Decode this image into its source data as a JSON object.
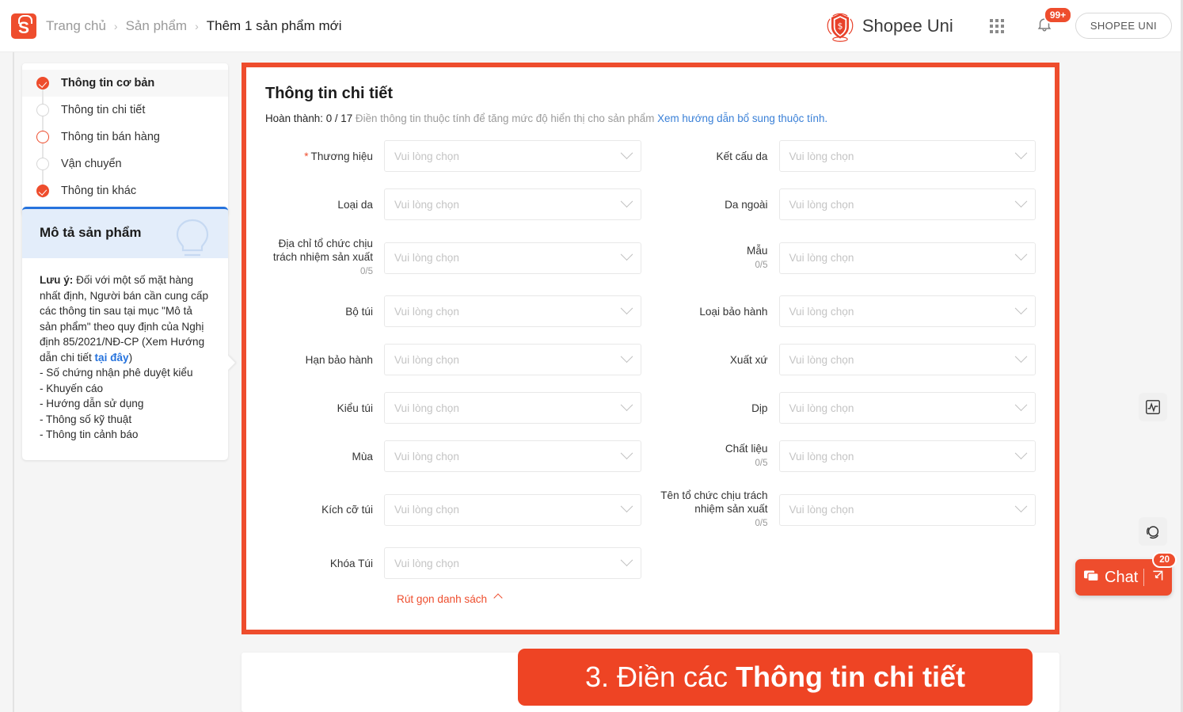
{
  "header": {
    "logo_icon": "shopee-bag-icon",
    "logo_letter": "S",
    "breadcrumb": [
      {
        "label": "Trang chủ",
        "active": false
      },
      {
        "label": "Sản phẩm",
        "active": false
      },
      {
        "label": "Thêm 1 sản phẩm mới",
        "active": true
      }
    ],
    "separator": "›",
    "uni_title": "Shopee Uni",
    "uni_logo_icon": "shopee-uni-shield-icon",
    "grid_icon": "apps-grid-icon",
    "bell_icon": "notification-bell-icon",
    "notification_badge": "99+",
    "account_pill": "SHOPEE UNI"
  },
  "sidebar": {
    "items": [
      {
        "label": "Thông tin cơ bản",
        "state": "done",
        "current": true
      },
      {
        "label": "Thông tin chi tiết",
        "state": "empty",
        "current": false
      },
      {
        "label": "Thông tin bán hàng",
        "state": "active-ring",
        "current": false
      },
      {
        "label": "Vận chuyển",
        "state": "empty",
        "current": false
      },
      {
        "label": "Thông tin khác",
        "state": "done",
        "current": false
      }
    ]
  },
  "description_card": {
    "title": "Mô tả sản phẩm",
    "bulb_icon": "lightbulb-icon",
    "note_label": "Lưu ý:",
    "note_text": " Đối với một số mặt hàng nhất định, Người bán cần cung cấp các thông tin sau tại mục \"Mô tả sản phẩm\" theo quy định của Nghị định 85/2021/NĐ-CP (Xem Hướng dẫn chi tiết ",
    "note_link": "tại đây",
    "note_text_after": ")",
    "bullets": [
      "- Số chứng nhận phê duyệt kiểu",
      "- Khuyến cáo",
      "- Hướng dẫn sử dụng",
      "- Thông số kỹ thuật",
      "- Thông tin cảnh báo"
    ]
  },
  "main": {
    "title": "Thông tin chi tiết",
    "progress_prefix": "Hoàn thành: ",
    "progress_value": "0 / 17",
    "progress_text": " Điền thông tin thuộc tính để tăng mức độ hiển thị cho sản phẩm ",
    "progress_link": "Xem hướng dẫn bổ sung thuộc tính.",
    "placeholder": "Vui lòng chọn",
    "chevron_icon": "chevron-down-icon",
    "collapse_label": "Rút gọn danh sách",
    "collapse_icon": "chevron-up-icon",
    "fields_left": [
      {
        "label": "Thương hiệu",
        "required": true,
        "count": ""
      },
      {
        "label": "Loại da",
        "required": false,
        "count": ""
      },
      {
        "label": "Địa chỉ tổ chức chịu trách nhiệm sản xuất",
        "required": false,
        "count": "0/5"
      },
      {
        "label": "Bộ túi",
        "required": false,
        "count": ""
      },
      {
        "label": "Hạn bảo hành",
        "required": false,
        "count": ""
      },
      {
        "label": "Kiểu túi",
        "required": false,
        "count": ""
      },
      {
        "label": "Mùa",
        "required": false,
        "count": ""
      },
      {
        "label": "Kích cỡ túi",
        "required": false,
        "count": ""
      },
      {
        "label": "Khóa Túi",
        "required": false,
        "count": ""
      }
    ],
    "fields_right": [
      {
        "label": "Kết cấu da",
        "required": false,
        "count": ""
      },
      {
        "label": "Da ngoài",
        "required": false,
        "count": ""
      },
      {
        "label": "Mẫu",
        "required": false,
        "count": "0/5"
      },
      {
        "label": "Loại bảo hành",
        "required": false,
        "count": ""
      },
      {
        "label": "Xuất xứ",
        "required": false,
        "count": ""
      },
      {
        "label": "Dịp",
        "required": false,
        "count": ""
      },
      {
        "label": "Chất liệu",
        "required": false,
        "count": "0/5"
      },
      {
        "label": "Tên tổ chức chịu trách nhiệm sản xuất",
        "required": false,
        "count": "0/5"
      }
    ]
  },
  "callout": {
    "step": "3. Điền các ",
    "emphasis": "Thông tin chi tiết"
  },
  "floating": {
    "chart_icon": "activity-chart-icon",
    "circle_icon": "loading-circle-icon",
    "chat_label": "Chat",
    "chat_icon": "chat-bubble-icon",
    "chat_expand_icon": "expand-arrow-icon",
    "chat_badge": "20"
  },
  "colors": {
    "accent": "#ee4d2d",
    "callout_bg": "#ee4424",
    "link_blue": "#3a80d7",
    "desc_blue": "#2673dd",
    "desc_head_bg": "#e3edfa"
  }
}
